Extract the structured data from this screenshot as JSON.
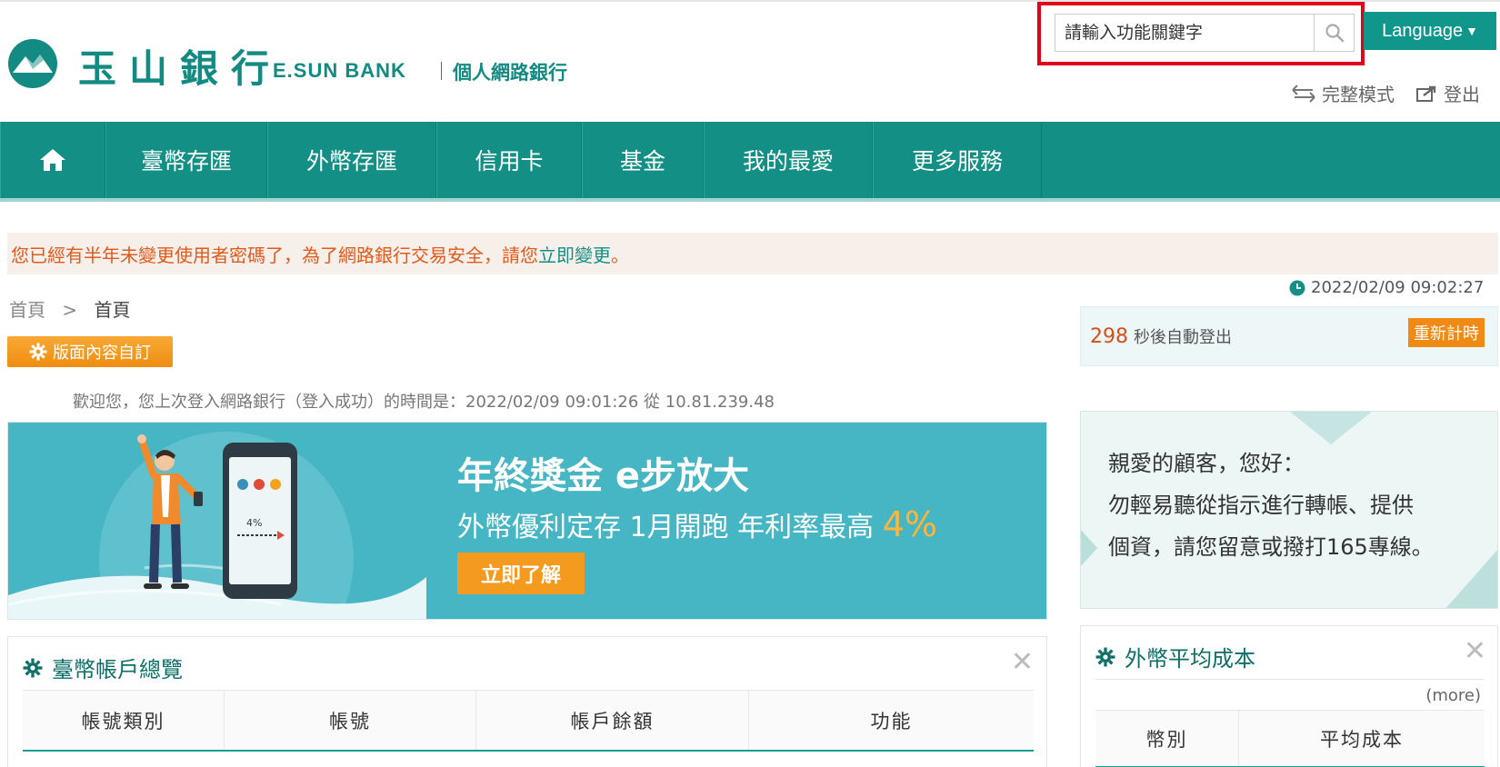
{
  "header": {
    "logo_cn": "玉山銀行",
    "logo_en": "E.SUN BANK",
    "logo_sub": "個人網路銀行",
    "search_placeholder": "請輸入功能關鍵字",
    "language": "Language",
    "full_mode": "完整模式",
    "logout": "登出"
  },
  "nav": {
    "items": [
      "臺幣存匯",
      "外幣存匯",
      "信用卡",
      "基金",
      "我的最愛",
      "更多服務"
    ]
  },
  "alert": {
    "text": "您已經有半年未變更使用者密碼了，為了網路銀行交易安全，請您",
    "link": "立即變更",
    "end": "。"
  },
  "clock": "2022/02/09 09:02:27",
  "breadcrumb": {
    "home": "首頁",
    "sep": ">",
    "current": "首頁"
  },
  "customize_button": "版面內容自訂",
  "welcome": "歡迎您，您上次登入網路銀行（登入成功）的時間是：2022/02/09 09:01:26 從 10.81.239.48",
  "banner": {
    "title": "年終獎金 e步放大",
    "subtitle": "外幣優利定存 1月開跑 年利率最高 ",
    "rate": "4%",
    "button": "立即了解",
    "phone_label": "4%"
  },
  "session": {
    "seconds": "298",
    "text": "秒後自動登出",
    "reset": "重新計時"
  },
  "notice": {
    "line1": "親愛的顧客，您好：",
    "line2": "勿輕易聽從指示進行轉帳、提供",
    "line3": "個資，請您留意或撥打165專線。"
  },
  "twd_panel": {
    "title": "臺幣帳戶總覽",
    "columns": [
      "帳號類別",
      "帳號",
      "帳戶餘額",
      "功能"
    ]
  },
  "fx_panel": {
    "title": "外幣平均成本",
    "more": "(more)",
    "columns": [
      "幣別",
      "平均成本"
    ]
  },
  "colors": {
    "brand": "#138f86",
    "accent": "#f49a1e",
    "alert": "#e25a1c",
    "highlight": "#e2001a"
  }
}
